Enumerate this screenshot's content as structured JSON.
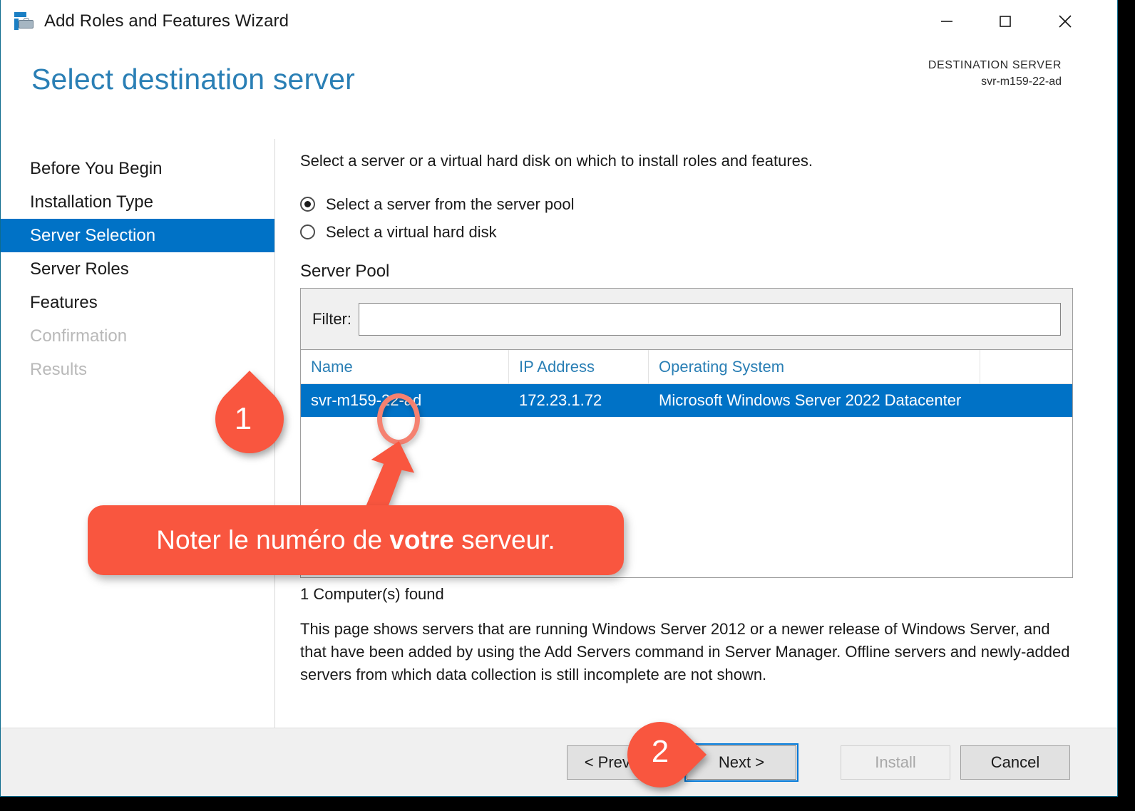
{
  "window": {
    "title": "Add Roles and Features Wizard",
    "icon": "wizard-toolbox-icon",
    "controls": {
      "minimize": "minimize-icon",
      "maximize": "maximize-icon",
      "close": "close-icon"
    }
  },
  "header": {
    "page_title": "Select destination server",
    "destination_label": "DESTINATION SERVER",
    "destination_value": "svr-m159-22-ad"
  },
  "sidebar": {
    "items": [
      {
        "label": "Before You Begin",
        "state": "normal"
      },
      {
        "label": "Installation Type",
        "state": "normal"
      },
      {
        "label": "Server Selection",
        "state": "selected"
      },
      {
        "label": "Server Roles",
        "state": "normal"
      },
      {
        "label": "Features",
        "state": "normal"
      },
      {
        "label": "Confirmation",
        "state": "disabled"
      },
      {
        "label": "Results",
        "state": "disabled"
      }
    ]
  },
  "content": {
    "intro": "Select a server or a virtual hard disk on which to install roles and features.",
    "radios": [
      {
        "label": "Select a server from the server pool",
        "checked": true
      },
      {
        "label": "Select a virtual hard disk",
        "checked": false
      }
    ],
    "server_pool_label": "Server Pool",
    "filter": {
      "label": "Filter:",
      "value": "",
      "placeholder": ""
    },
    "table": {
      "columns": [
        "Name",
        "IP Address",
        "Operating System",
        ""
      ],
      "rows": [
        {
          "name": "svr-m159-22-ad",
          "ip": "172.23.1.72",
          "os": "Microsoft Windows Server 2022 Datacenter",
          "extra": "",
          "selected": true
        }
      ]
    },
    "computers_found": "1 Computer(s) found",
    "note": "This page shows servers that are running Windows Server 2012 or a newer release of Windows Server, and that have been added by using the Add Servers command in Server Manager. Offline servers and newly-added servers from which data collection is still incomplete are not shown."
  },
  "footer": {
    "previous": "< Previous",
    "next": "Next >",
    "install": "Install",
    "cancel": "Cancel"
  },
  "annotations": {
    "pin1": "1",
    "pin2": "2",
    "callout_prefix": "Noter le numéro de ",
    "callout_bold": "votre",
    "callout_suffix": " serveur.",
    "highlight_target": "server-number-22",
    "accent_color": "#f9563f",
    "highlight_color": "#f58170"
  },
  "colors": {
    "brand_blue": "#2a7fb5",
    "selection_blue": "#0072c6",
    "focus_blue": "#0078d7",
    "window_border": "#0e6c8e"
  }
}
